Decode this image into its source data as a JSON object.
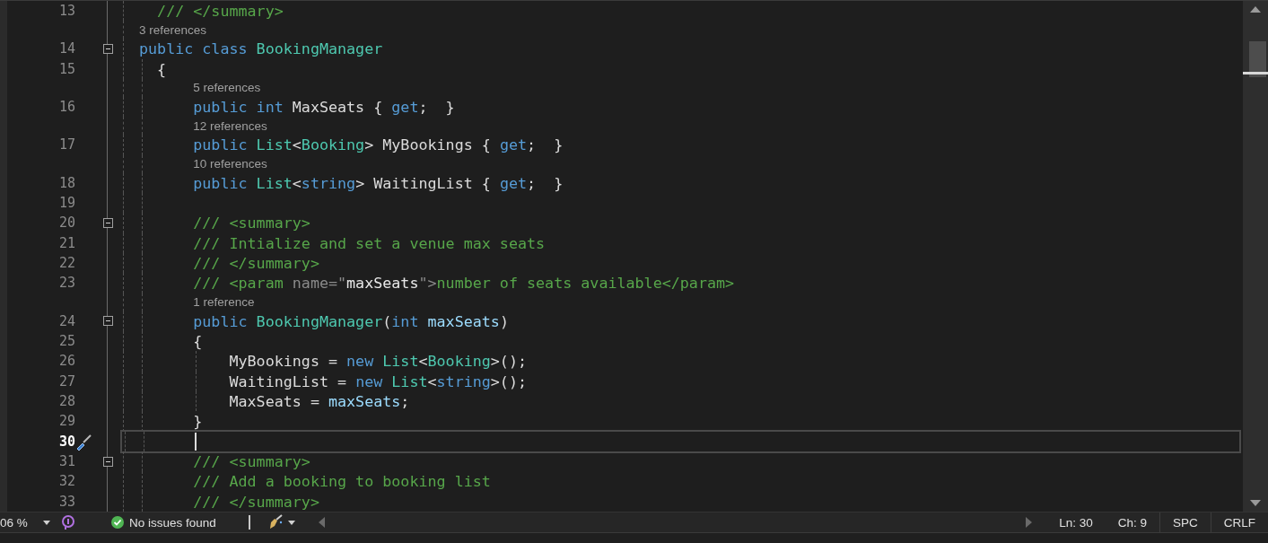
{
  "editor": {
    "lines": [
      {
        "number": "13",
        "current": false,
        "collapse": false,
        "tokens": [
          {
            "kind": "comment",
            "text": "  /// </summary>"
          }
        ]
      },
      {
        "number": "14",
        "current": false,
        "collapse": true,
        "lens": "3 references",
        "tokens": [
          {
            "kind": "keyword",
            "text": "public "
          },
          {
            "kind": "keyword",
            "text": "class "
          },
          {
            "kind": "type",
            "text": "BookingManager"
          }
        ]
      },
      {
        "number": "15",
        "current": false,
        "collapse": false,
        "tokens": [
          {
            "kind": "plain",
            "text": "  {"
          }
        ]
      },
      {
        "number": "16",
        "current": false,
        "collapse": false,
        "lens": "5 references",
        "tokens": [
          {
            "kind": "keyword",
            "text": "      public "
          },
          {
            "kind": "keyword",
            "text": "int "
          },
          {
            "kind": "plain",
            "text": "MaxSeats { "
          },
          {
            "kind": "keyword",
            "text": "get"
          },
          {
            "kind": "plain",
            "text": ";  }"
          }
        ]
      },
      {
        "number": "17",
        "current": false,
        "collapse": false,
        "lens": "12 references",
        "tokens": [
          {
            "kind": "keyword",
            "text": "      public "
          },
          {
            "kind": "type",
            "text": "List"
          },
          {
            "kind": "plain",
            "text": "<"
          },
          {
            "kind": "type",
            "text": "Booking"
          },
          {
            "kind": "plain",
            "text": "> MyBookings { "
          },
          {
            "kind": "keyword",
            "text": "get"
          },
          {
            "kind": "plain",
            "text": ";  }"
          }
        ]
      },
      {
        "number": "18",
        "current": false,
        "collapse": false,
        "lens": "10 references",
        "tokens": [
          {
            "kind": "keyword",
            "text": "      public "
          },
          {
            "kind": "type",
            "text": "List"
          },
          {
            "kind": "plain",
            "text": "<"
          },
          {
            "kind": "keyword",
            "text": "string"
          },
          {
            "kind": "plain",
            "text": "> WaitingList { "
          },
          {
            "kind": "keyword",
            "text": "get"
          },
          {
            "kind": "plain",
            "text": ";  }"
          }
        ]
      },
      {
        "number": "19",
        "current": false,
        "collapse": false
      },
      {
        "number": "20",
        "current": false,
        "collapse": true,
        "tokens": [
          {
            "kind": "comment",
            "text": "      /// <summary>"
          }
        ]
      },
      {
        "number": "21",
        "current": false,
        "collapse": false,
        "tokens": [
          {
            "kind": "comment",
            "text": "      /// Intialize and set a venue max seats"
          }
        ]
      },
      {
        "number": "22",
        "current": false,
        "collapse": false,
        "tokens": [
          {
            "kind": "comment",
            "text": "      /// </summary>"
          }
        ]
      },
      {
        "number": "23",
        "current": false,
        "collapse": false,
        "tokens": [
          {
            "kind": "comment",
            "text": "      /// <param "
          },
          {
            "kind": "doc",
            "text": "name"
          },
          {
            "kind": "doc",
            "text": "=\""
          },
          {
            "kind": "docvalue",
            "text": "maxSeats"
          },
          {
            "kind": "doc",
            "text": "\">"
          },
          {
            "kind": "comment",
            "text": "number of seats available</param>"
          }
        ]
      },
      {
        "number": "24",
        "current": false,
        "collapse": true,
        "lens": "1 reference",
        "tokens": [
          {
            "kind": "keyword",
            "text": "      public "
          },
          {
            "kind": "type",
            "text": "BookingManager"
          },
          {
            "kind": "plain",
            "text": "("
          },
          {
            "kind": "keyword",
            "text": "int "
          },
          {
            "kind": "param",
            "text": "maxSeats"
          },
          {
            "kind": "plain",
            "text": ")"
          }
        ]
      },
      {
        "number": "25",
        "current": false,
        "collapse": false,
        "tokens": [
          {
            "kind": "plain",
            "text": "      {"
          }
        ]
      },
      {
        "number": "26",
        "current": false,
        "collapse": false,
        "tokens": [
          {
            "kind": "plain",
            "text": "          MyBookings = "
          },
          {
            "kind": "keyword",
            "text": "new "
          },
          {
            "kind": "type",
            "text": "List"
          },
          {
            "kind": "plain",
            "text": "<"
          },
          {
            "kind": "type",
            "text": "Booking"
          },
          {
            "kind": "plain",
            "text": ">();"
          }
        ]
      },
      {
        "number": "27",
        "current": false,
        "collapse": false,
        "tokens": [
          {
            "kind": "plain",
            "text": "          WaitingList = "
          },
          {
            "kind": "keyword",
            "text": "new "
          },
          {
            "kind": "type",
            "text": "List"
          },
          {
            "kind": "plain",
            "text": "<"
          },
          {
            "kind": "keyword",
            "text": "string"
          },
          {
            "kind": "plain",
            "text": ">();"
          }
        ]
      },
      {
        "number": "28",
        "current": false,
        "collapse": false,
        "tokens": [
          {
            "kind": "plain",
            "text": "          MaxSeats = "
          },
          {
            "kind": "param",
            "text": "maxSeats"
          },
          {
            "kind": "plain",
            "text": ";"
          }
        ]
      },
      {
        "number": "29",
        "current": false,
        "collapse": false,
        "tokens": [
          {
            "kind": "plain",
            "text": "      }"
          }
        ]
      },
      {
        "number": "30",
        "current": true,
        "collapse": false
      },
      {
        "number": "31",
        "current": false,
        "collapse": true,
        "tokens": [
          {
            "kind": "comment",
            "text": "      /// <summary>"
          }
        ]
      },
      {
        "number": "32",
        "current": false,
        "collapse": false,
        "tokens": [
          {
            "kind": "comment",
            "text": "      /// Add a booking to booking list"
          }
        ]
      },
      {
        "number": "33",
        "current": false,
        "collapse": false,
        "tokens": [
          {
            "kind": "comment",
            "text": "      /// </summary>"
          }
        ]
      }
    ]
  },
  "status_bar": {
    "zoom": "06 %",
    "issues": "No issues found",
    "line": "Ln: 30",
    "column": "Ch: 9",
    "whitespace": "SPC",
    "line_ending": "CRLF"
  }
}
